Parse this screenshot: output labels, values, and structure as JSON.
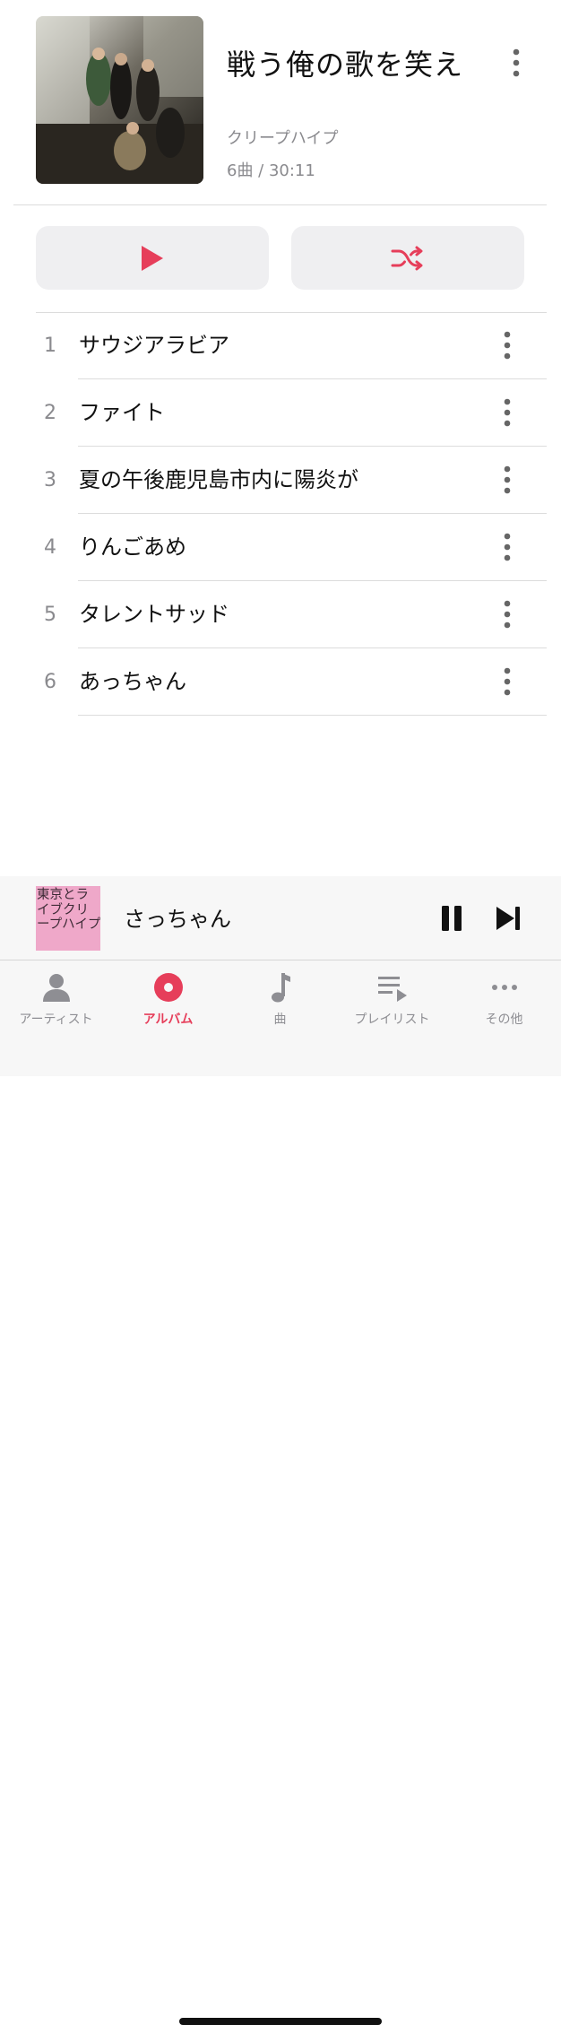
{
  "album": {
    "title": "戦う俺の歌を笑え",
    "artist": "クリープハイプ",
    "meta": "6曲 / 30:11"
  },
  "actions": {
    "play_icon": "play-icon",
    "shuffle_icon": "shuffle-icon"
  },
  "tracks": [
    {
      "number": "1",
      "title": "サウジアラビア"
    },
    {
      "number": "2",
      "title": "ファイト"
    },
    {
      "number": "3",
      "title": "夏の午後鹿児島市内に陽炎が"
    },
    {
      "number": "4",
      "title": "りんごあめ"
    },
    {
      "number": "5",
      "title": "タレントサッド"
    },
    {
      "number": "6",
      "title": "あっちゃん"
    }
  ],
  "now_playing": {
    "title": "さっちゃん",
    "artwork_text": "東京とライブクリープハイプ"
  },
  "tabs": [
    {
      "label": "アーティスト",
      "icon": "person-icon",
      "active": false
    },
    {
      "label": "アルバム",
      "icon": "album-icon",
      "active": true
    },
    {
      "label": "曲",
      "icon": "music-note-icon",
      "active": false
    },
    {
      "label": "プレイリスト",
      "icon": "playlist-icon",
      "active": false
    },
    {
      "label": "その他",
      "icon": "ellipsis-icon",
      "active": false
    }
  ],
  "colors": {
    "accent": "#e63e5a",
    "secondary_text": "#8a8a8e",
    "button_bg": "#efeff1"
  }
}
